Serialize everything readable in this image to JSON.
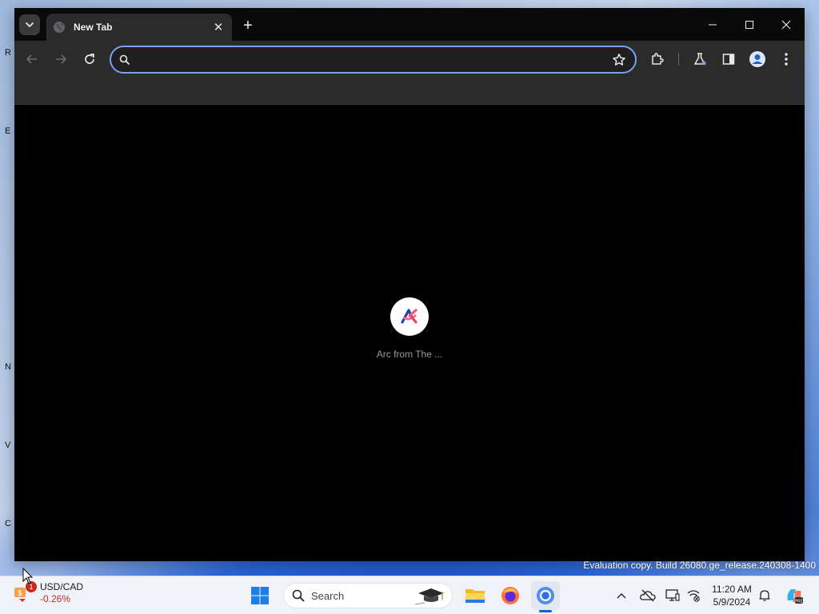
{
  "desktop": {
    "icon_fragments": [
      "R",
      "E",
      "N",
      "V",
      "C"
    ]
  },
  "browser": {
    "tab": {
      "title": "New Tab",
      "favicon": "globe-icon",
      "close_glyph": "✕"
    },
    "new_tab_glyph": "+",
    "window_controls": [
      "minimize-icon",
      "maximize-icon",
      "close-icon"
    ],
    "toolbar": {
      "back": "back-arrow-icon",
      "forward": "forward-arrow-icon",
      "reload": "reload-icon",
      "omnibox": {
        "value": "",
        "placeholder": "",
        "focused": true
      },
      "icons": [
        "bookmark-star-icon",
        "extensions-icon",
        "labs-flask-icon",
        "side-panel-icon",
        "profile-icon",
        "more-menu-icon"
      ]
    },
    "content": {
      "background": "#000000",
      "shortcuts": [
        {
          "label": "Arc from The ...",
          "icon": "arc-logo-icon"
        }
      ]
    }
  },
  "watermark": "Evaluation copy. Build 26080.ge_release.240308-1400",
  "taskbar": {
    "widget": {
      "title": "USD/CAD",
      "change": "-0.26%",
      "badge": "1",
      "change_color": "#c42b1c"
    },
    "search": {
      "label": "Search"
    },
    "pinned_apps": [
      "windows-start-icon",
      "file-explorer-icon",
      "firefox-icon",
      "chrome-icon"
    ],
    "active_app": "chrome-icon",
    "tray": [
      "show-hidden-icons-chevron",
      "onedrive-offline-icon",
      "display-icon",
      "network-icon",
      "notifications-bell-icon",
      "copilot-icon"
    ],
    "clock": {
      "time": "11:20 AM",
      "date": "5/9/2024"
    }
  },
  "colors": {
    "accent_focus_ring": "#7ba0ee",
    "toolbar_bg": "#2b2b2b",
    "tabstrip_bg": "#0a0a0a",
    "taskbar_bg": "#f1f3f8"
  }
}
